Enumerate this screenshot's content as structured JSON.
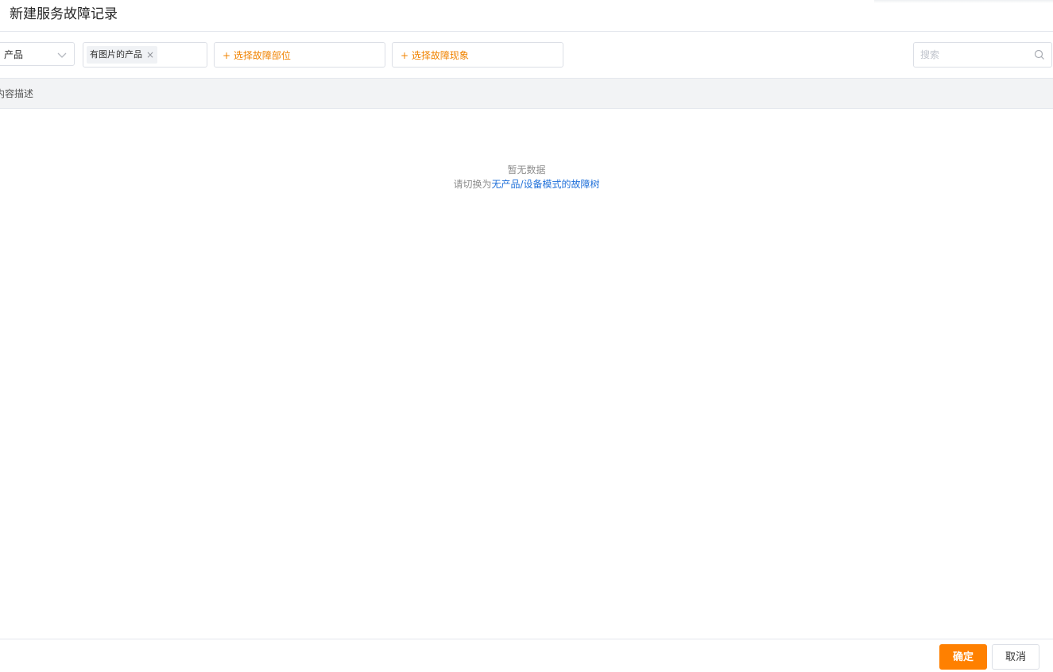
{
  "dialog": {
    "title": "新建服务故障记录"
  },
  "filters": {
    "mode_select": {
      "value": "产品"
    },
    "tag_input": {
      "tags": [
        {
          "label": "有图片的产品",
          "close": "×"
        }
      ]
    },
    "part_picker": {
      "label": "+ 选择故障部位"
    },
    "phenomenon_picker": {
      "label": "+ 选择故障现象"
    },
    "search": {
      "placeholder": "搜索",
      "value": ""
    }
  },
  "table": {
    "columns": [
      "内容描述"
    ],
    "rows": []
  },
  "empty_state": {
    "title": "暂无数据",
    "hint_prefix": "请切换为",
    "hint_link": "无产品/设备模式的故障树"
  },
  "footer": {
    "confirm_label": "确定",
    "cancel_label": "取消"
  },
  "colors": {
    "accent": "#ff8000",
    "picker_text": "#f08300",
    "link": "#1e6fd9",
    "header_bg": "#f2f3f5",
    "border": "#dcdfe6"
  },
  "icons": {
    "mode_select": "chevron-down-icon",
    "tag_remove": "close-icon",
    "search": "search-icon"
  }
}
